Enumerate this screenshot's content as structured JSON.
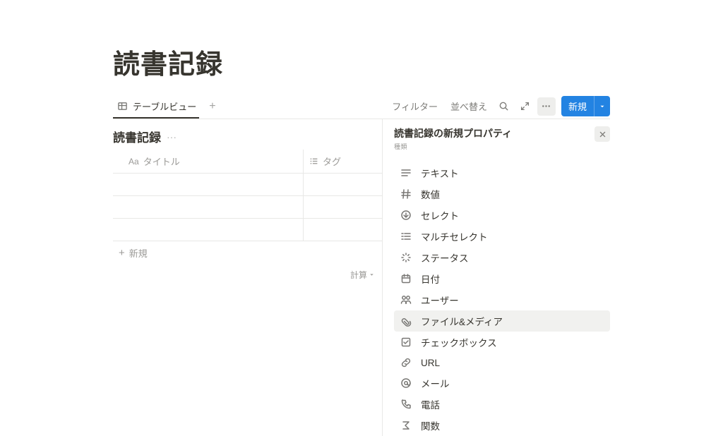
{
  "page": {
    "title": "読書記録"
  },
  "toolbar": {
    "view_label": "テーブルビュー",
    "filter": "フィルター",
    "sort": "並べ替え",
    "new": "新規"
  },
  "database": {
    "title": "読書記録",
    "columns": {
      "title": "タイトル",
      "tag": "タグ"
    },
    "add_row": "新規",
    "calc": "計算"
  },
  "panel": {
    "title": "読書記録の新規プロパティ",
    "sub": "種類",
    "items": [
      {
        "icon": "text",
        "label": "テキスト",
        "hover": false
      },
      {
        "icon": "number",
        "label": "数値",
        "hover": false
      },
      {
        "icon": "select",
        "label": "セレクト",
        "hover": false
      },
      {
        "icon": "multiselect",
        "label": "マルチセレクト",
        "hover": false
      },
      {
        "icon": "status",
        "label": "ステータス",
        "hover": false
      },
      {
        "icon": "date",
        "label": "日付",
        "hover": false
      },
      {
        "icon": "person",
        "label": "ユーザー",
        "hover": false
      },
      {
        "icon": "file",
        "label": "ファイル&メディア",
        "hover": true
      },
      {
        "icon": "checkbox",
        "label": "チェックボックス",
        "hover": false
      },
      {
        "icon": "url",
        "label": "URL",
        "hover": false
      },
      {
        "icon": "email",
        "label": "メール",
        "hover": false
      },
      {
        "icon": "phone",
        "label": "電話",
        "hover": false
      },
      {
        "icon": "formula",
        "label": "関数",
        "hover": false
      }
    ]
  }
}
